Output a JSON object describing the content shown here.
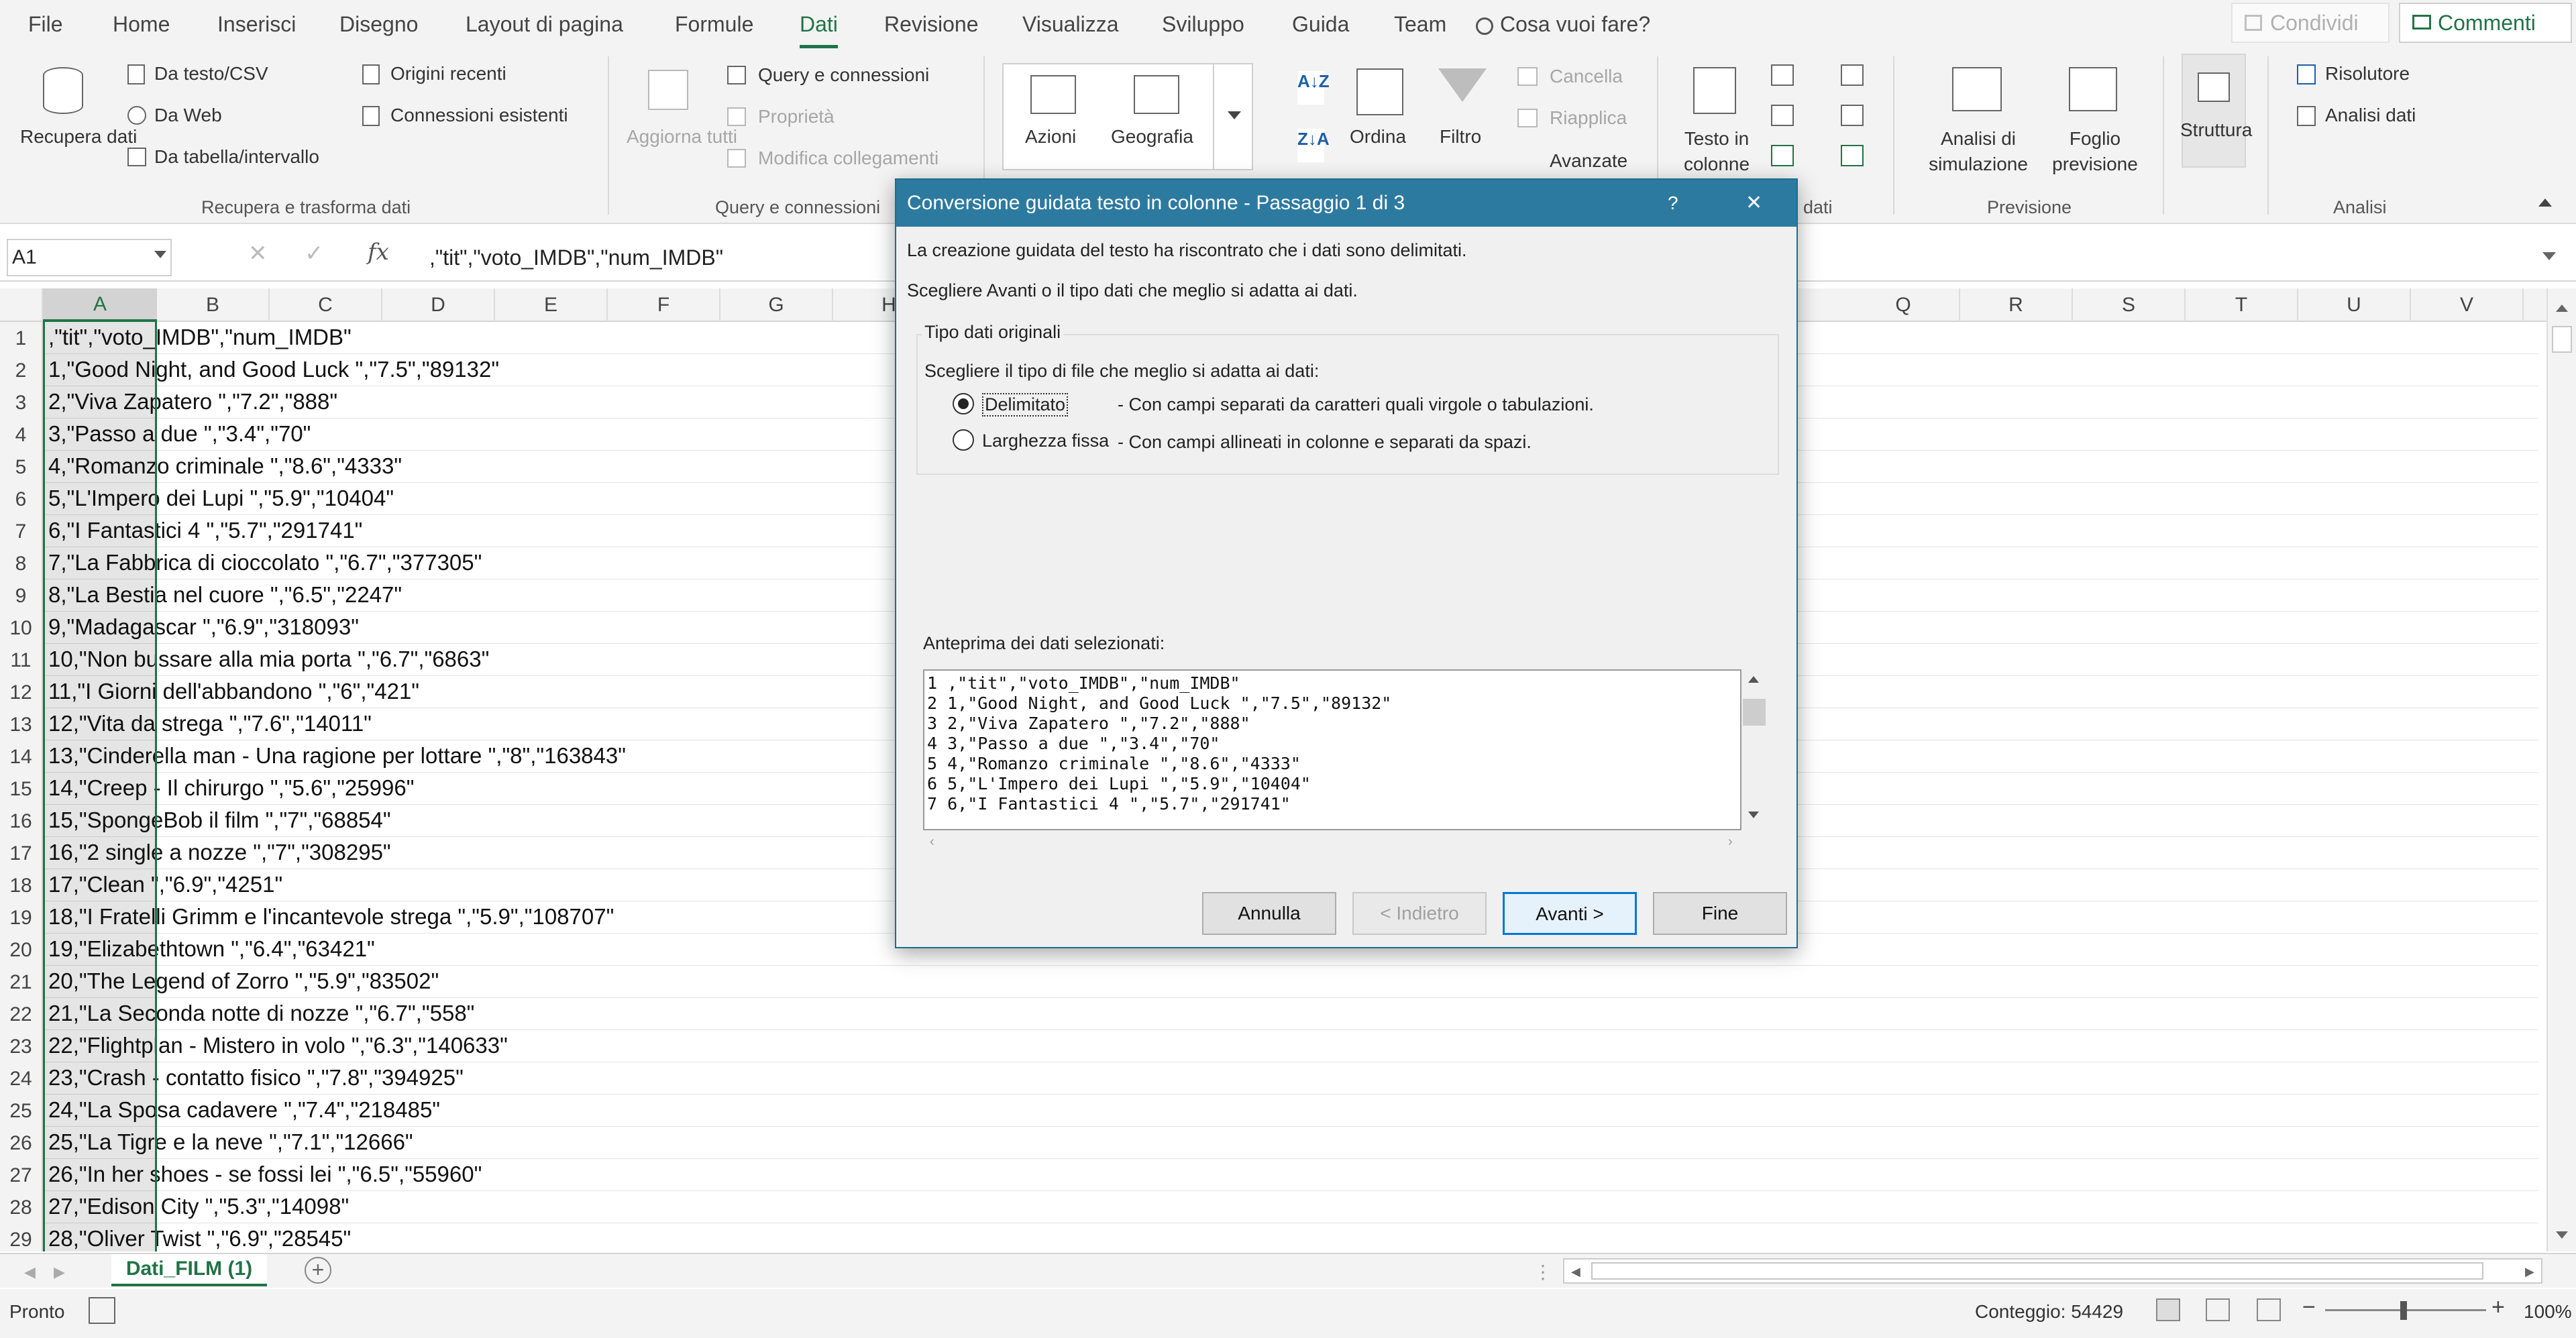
{
  "menu": {
    "tabs": [
      "File",
      "Home",
      "Inserisci",
      "Disegno",
      "Layout di pagina",
      "Formule",
      "Dati",
      "Revisione",
      "Visualizza",
      "Sviluppo",
      "Guida",
      "Team"
    ],
    "active": "Dati",
    "tell_me": "Cosa vuoi fare?",
    "share": "Condividi",
    "comments": "Commenti"
  },
  "ribbon": {
    "get_data": "Recupera dati",
    "from_text": "Da testo/CSV",
    "from_web": "Da Web",
    "from_table": "Da tabella/intervallo",
    "recent_sources": "Origini recenti",
    "existing_connections": "Connessioni esistenti",
    "group_get_transform": "Recupera e trasforma dati",
    "refresh_all": "Aggiorna tutti",
    "queries_connections": "Query e connessioni",
    "properties": "Proprietà",
    "edit_links": "Modifica collegamenti",
    "group_queries": "Query e connessioni",
    "stocks": "Azioni",
    "geography": "Geografia",
    "sort": "Ordina",
    "filter": "Filtro",
    "clear": "Cancella",
    "reapply": "Riapplica",
    "advanced": "Avanzate",
    "text_to_columns": "Testo in colonne",
    "group_data_tools_tail": "dati",
    "what_if": "Analisi di simulazione",
    "forecast_sheet": "Foglio previsione",
    "group_forecast": "Previsione",
    "outline": "Struttura",
    "solver": "Risolutore",
    "data_analysis": "Analisi dati",
    "group_analysis": "Analisi"
  },
  "formula": {
    "name_box": "A1",
    "content": ",\"tit\",\"voto_IMDB\",\"num_IMDB\""
  },
  "grid": {
    "columns": [
      "A",
      "B",
      "C",
      "D",
      "E",
      "F",
      "G",
      "H",
      "",
      "",
      "",
      "",
      "",
      "",
      "",
      "",
      "Q",
      "R",
      "S",
      "T",
      "U",
      "V"
    ],
    "rows": [
      ",\"tit\",\"voto_IMDB\",\"num_IMDB\"",
      "1,\"Good Night, and Good Luck \",\"7.5\",\"89132\"",
      "2,\"Viva Zapatero \",\"7.2\",\"888\"",
      "3,\"Passo a due \",\"3.4\",\"70\"",
      "4,\"Romanzo criminale \",\"8.6\",\"4333\"",
      "5,\"L'Impero dei Lupi \",\"5.9\",\"10404\"",
      "6,\"I Fantastici 4 \",\"5.7\",\"291741\"",
      "7,\"La Fabbrica di cioccolato \",\"6.7\",\"377305\"",
      "8,\"La Bestia nel cuore \",\"6.5\",\"2247\"",
      "9,\"Madagascar \",\"6.9\",\"318093\"",
      "10,\"Non bussare alla mia porta \",\"6.7\",\"6863\"",
      "11,\"I Giorni dell'abbandono \",\"6\",\"421\"",
      "12,\"Vita da strega \",\"7.6\",\"14011\"",
      "13,\"Cinderella man - Una ragione per lottare \",\"8\",\"163843\"",
      "14,\"Creep - Il chirurgo \",\"5.6\",\"25996\"",
      "15,\"SpongeBob il film \",\"7\",\"68854\"",
      "16,\"2 single a nozze \",\"7\",\"308295\"",
      "17,\"Clean \",\"6.9\",\"4251\"",
      "18,\"I Fratelli Grimm e l'incantevole strega \",\"5.9\",\"108707\"",
      "19,\"Elizabethtown \",\"6.4\",\"63421\"",
      "20,\"The Legend of Zorro \",\"5.9\",\"83502\"",
      "21,\"La Seconda notte di nozze \",\"6.7\",\"558\"",
      "22,\"Flightplan - Mistero in volo \",\"6.3\",\"140633\"",
      "23,\"Crash - contatto fisico \",\"7.8\",\"394925\"",
      "24,\"La Sposa cadavere \",\"7.4\",\"218485\"",
      "25,\"La Tigre e la neve \",\"7.1\",\"12666\"",
      "26,\"In her shoes - se fossi lei \",\"6.5\",\"55960\"",
      "27,\"Edison City \",\"5.3\",\"14098\"",
      "28,\"Oliver Twist \",\"6.9\",\"28545\""
    ]
  },
  "sheet": {
    "tab": "Dati_FILM (1)"
  },
  "status": {
    "ready": "Pronto",
    "count": "Conteggio: 54429",
    "zoom": "100%"
  },
  "dialog": {
    "title": "Conversione guidata testo in colonne - Passaggio 1 di 3",
    "help": "?",
    "close": "✕",
    "line1": "La creazione guidata del testo ha riscontrato che i dati sono delimitati.",
    "line2": "Scegliere Avanti o il tipo dati che meglio si adatta ai dati.",
    "group_title": "Tipo dati originali",
    "group_prompt": "Scegliere il tipo di file che meglio si adatta ai dati:",
    "opt1_label": "Delimitato",
    "opt1_desc": "- Con campi separati da caratteri quali virgole o tabulazioni.",
    "opt2_label": "Larghezza fissa",
    "opt2_desc": "- Con campi allineati in colonne e separati da spazi.",
    "selected": "Delimitato",
    "preview_label": "Anteprima dei dati selezionati:",
    "preview_lines": [
      "1 ,\"tit\",\"voto_IMDB\",\"num_IMDB\"",
      "2 1,\"Good Night, and Good Luck \",\"7.5\",\"89132\"",
      "3 2,\"Viva Zapatero \",\"7.2\",\"888\"",
      "4 3,\"Passo a due \",\"3.4\",\"70\"",
      "5 4,\"Romanzo criminale \",\"8.6\",\"4333\"",
      "6 5,\"L'Impero dei Lupi \",\"5.9\",\"10404\"",
      "7 6,\"I Fantastici 4 \",\"5.7\",\"291741\""
    ],
    "buttons": {
      "cancel": "Annulla",
      "back": "< Indietro",
      "next": "Avanti >",
      "finish": "Fine"
    }
  },
  "colors": {
    "accent": "#217346",
    "dialog_title": "#2d7aa0"
  }
}
